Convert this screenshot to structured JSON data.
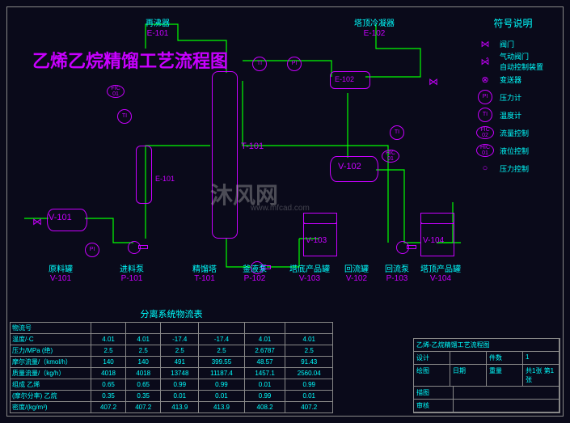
{
  "title": "乙烯乙烷精馏工艺流程图",
  "equipment": {
    "reboiler": {
      "name": "再沸器",
      "tag": "E-101"
    },
    "condenser": {
      "name": "塔顶冷凝器",
      "tag": "E-102"
    },
    "feed_tank": {
      "tag": "V-101",
      "label": "原料罐",
      "sub": "V-101"
    },
    "feed_pump": {
      "tag": "P-101",
      "label": "进料泵",
      "sub": "P-101"
    },
    "column": {
      "tag": "T-101",
      "label": "精馏塔",
      "sub": "T-101"
    },
    "bottom_pump": {
      "label": "釜液泵",
      "sub": "P-102"
    },
    "bottom_tank": {
      "tag": "V-103",
      "label": "塔底产品罐",
      "sub": "V-103"
    },
    "reflux_tank": {
      "tag": "V-102",
      "label": "回流罐",
      "sub": "V-102"
    },
    "reflux_pump": {
      "label": "回流泵",
      "sub": "P-103"
    },
    "top_tank": {
      "tag": "V-104",
      "label": "塔顶产品罐",
      "sub": "V-104"
    },
    "ex_e101": "E-101",
    "ex_e102": "E-102"
  },
  "instruments": {
    "pi": "PI",
    "ti": "TI",
    "fic": "FIC\n02",
    "hic": "HIC\n01"
  },
  "legend": {
    "title": "符号说明",
    "items": [
      {
        "sym": "⋈",
        "text": "阀门"
      },
      {
        "sym": "⋈̂",
        "text": "气动阀门\n自动控制装置"
      },
      {
        "sym": "⊗",
        "text": "变送器"
      },
      {
        "sym": "PI",
        "text": "压力计"
      },
      {
        "sym": "TI",
        "text": "温度计"
      },
      {
        "sym": "FIC\n02",
        "text": "流量控制"
      },
      {
        "sym": "HIC\n01",
        "text": "液位控制"
      },
      {
        "sym": "○",
        "text": "压力控制"
      }
    ]
  },
  "stream_table": {
    "title": "分离系统物流表",
    "rows": [
      {
        "h": "物流号",
        "c": [
          "",
          "",
          "",
          "",
          "",
          ""
        ]
      },
      {
        "h": "温度/·C",
        "c": [
          "4.01",
          "4.01",
          "-17.4",
          "-17.4",
          "4.01",
          "4.01"
        ]
      },
      {
        "h": "压力/MPa (绝)",
        "c": [
          "2.5",
          "2.5",
          "2.5",
          "2.5",
          "2.6787",
          "2.5"
        ]
      },
      {
        "h": "摩尔流量/（kmol/h）",
        "c": [
          "140",
          "140",
          "491",
          "399.55",
          "48.57",
          "91.43"
        ]
      },
      {
        "h": "质量流量/（kg/h）",
        "c": [
          "4018",
          "4018",
          "13748",
          "11187.4",
          "1457.1",
          "2560.04"
        ]
      },
      {
        "h": "组成  乙烯",
        "c": [
          "0.65",
          "0.65",
          "0.99",
          "0.99",
          "0.01",
          "0.99"
        ]
      },
      {
        "h": "(摩尔分率) 乙烷",
        "c": [
          "0.35",
          "0.35",
          "0.01",
          "0.01",
          "0.99",
          "0.01"
        ]
      },
      {
        "h": "密度/(kg/m³)",
        "c": [
          "407.2",
          "407.2",
          "413.9",
          "413.9",
          "408.2",
          "407.2"
        ]
      }
    ]
  },
  "titleblock": {
    "name": "乙烯-乙烷精馏工艺流程图",
    "count_label": "件数",
    "count": "1",
    "date_label": "日期",
    "weight_label": "重量",
    "sheet": "共1张 第1张",
    "rows": [
      "设计",
      "绘图",
      "描图",
      "审核"
    ]
  },
  "watermark": "沐风网",
  "watermark_url": "www.mfcad.com"
}
